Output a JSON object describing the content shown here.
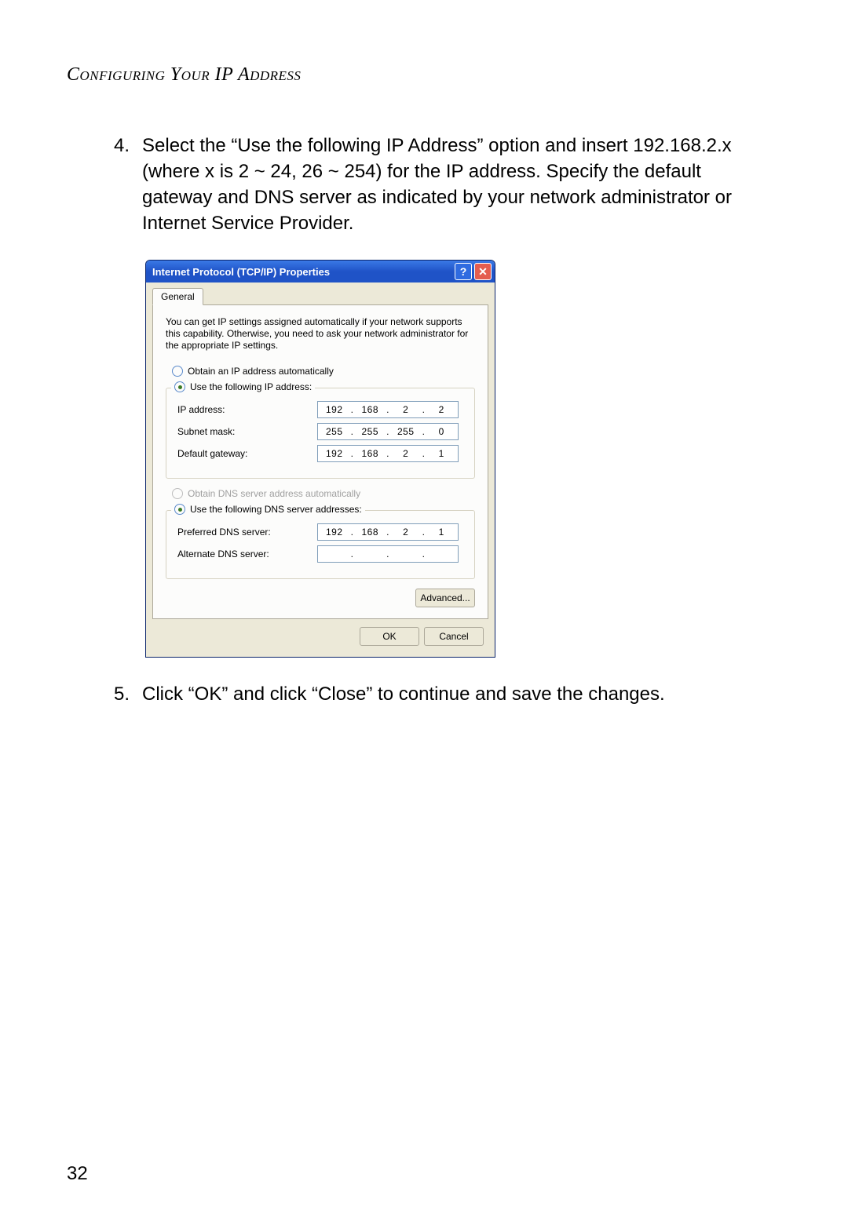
{
  "header": "Configuring Your IP Address",
  "steps": {
    "s4": {
      "num": "4.",
      "text": "Select the “Use the following IP Address” option and insert 192.168.2.x (where x is 2 ~ 24, 26 ~ 254) for the IP address. Specify the default gateway and DNS server as indicated by your network administrator or Internet Service Provider."
    },
    "s5": {
      "num": "5.",
      "text": "Click “OK” and click “Close” to continue and save the changes."
    }
  },
  "dialog": {
    "title": "Internet Protocol (TCP/IP) Properties",
    "help": "?",
    "close": "✕",
    "tab": "General",
    "description": "You can get IP settings assigned automatically if your network supports this capability. Otherwise, you need to ask your network administrator for the appropriate IP settings.",
    "radio_auto_ip": "Obtain an IP address automatically",
    "radio_use_ip": "Use the following IP address:",
    "ip": {
      "label": "IP address:",
      "o1": "192",
      "o2": "168",
      "o3": "2",
      "o4": "2"
    },
    "mask": {
      "label": "Subnet mask:",
      "o1": "255",
      "o2": "255",
      "o3": "255",
      "o4": "0"
    },
    "gw": {
      "label": "Default gateway:",
      "o1": "192",
      "o2": "168",
      "o3": "2",
      "o4": "1"
    },
    "radio_auto_dns": "Obtain DNS server address automatically",
    "radio_use_dns": "Use the following DNS server addresses:",
    "dns1": {
      "label": "Preferred DNS server:",
      "o1": "192",
      "o2": "168",
      "o3": "2",
      "o4": "1"
    },
    "dns2": {
      "label": "Alternate DNS server:",
      "o1": "",
      "o2": "",
      "o3": "",
      "o4": ""
    },
    "advanced": "Advanced...",
    "ok": "OK",
    "cancel": "Cancel"
  },
  "page_number": "32"
}
